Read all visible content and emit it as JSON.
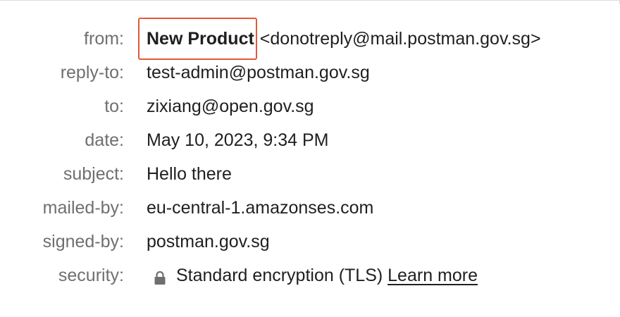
{
  "rows": {
    "from": {
      "label": "from:",
      "sender_name": "New Product",
      "sender_email": "<donotreply@mail.postman.gov.sg>"
    },
    "reply_to": {
      "label": "reply-to:",
      "value": "test-admin@postman.gov.sg"
    },
    "to": {
      "label": "to:",
      "value": "zixiang@open.gov.sg"
    },
    "date": {
      "label": "date:",
      "value": "May 10, 2023, 9:34 PM"
    },
    "subject": {
      "label": "subject:",
      "value": "Hello there"
    },
    "mailed_by": {
      "label": "mailed-by:",
      "value": "eu-central-1.amazonses.com"
    },
    "signed_by": {
      "label": "signed-by:",
      "value": "postman.gov.sg"
    },
    "security": {
      "label": "security:",
      "icon": "lock-icon",
      "value": "Standard encryption (TLS)",
      "link_label": "Learn more"
    }
  },
  "colors": {
    "label_text": "#6f6f6f",
    "value_text": "#1f1f1f",
    "highlight_border": "#e2593b",
    "icon_gray": "#6f6f6f"
  }
}
